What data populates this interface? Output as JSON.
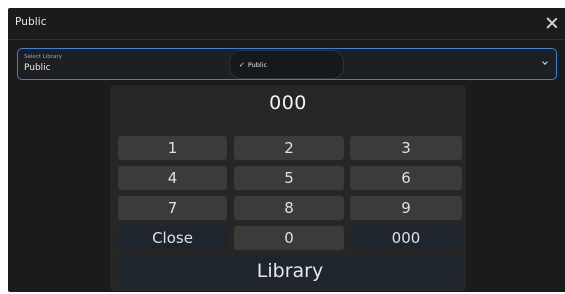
{
  "dialog": {
    "title": "Public",
    "close_icon": "close-icon"
  },
  "library_select": {
    "label": "Select Library",
    "value": "Public",
    "selected_option": "Public",
    "check_icon": "checkmark-icon",
    "chevron_icon": "chevron-down-icon"
  },
  "numpad": {
    "display": "000",
    "keys": [
      {
        "label": "1"
      },
      {
        "label": "2"
      },
      {
        "label": "3"
      },
      {
        "label": "4"
      },
      {
        "label": "5"
      },
      {
        "label": "6"
      },
      {
        "label": "7"
      },
      {
        "label": "8"
      },
      {
        "label": "9"
      },
      {
        "label": "Close"
      },
      {
        "label": "0"
      },
      {
        "label": "000"
      }
    ],
    "library_button": "Library"
  },
  "colors": {
    "background": "#1b1b1b",
    "select_border": "#3f7fd4",
    "key_light": "#3b3b3b",
    "key_dark": "#1f252d"
  }
}
